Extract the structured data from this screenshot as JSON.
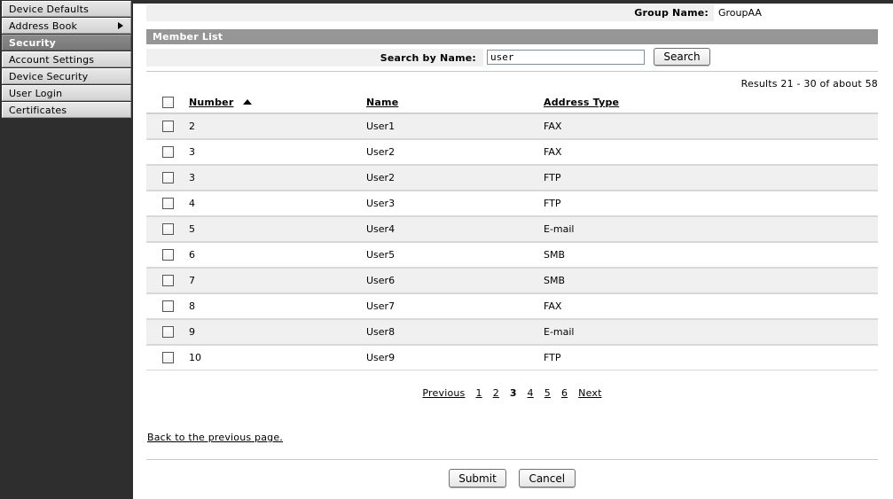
{
  "sidebar": {
    "items": [
      {
        "label": "Device Defaults",
        "selected": false,
        "has_arrow": false
      },
      {
        "label": "Address Book",
        "selected": false,
        "has_arrow": true
      },
      {
        "label": "Security",
        "selected": true,
        "has_arrow": false
      },
      {
        "label": "Account Settings",
        "selected": false,
        "has_arrow": false
      },
      {
        "label": "Device Security",
        "selected": false,
        "has_arrow": false
      },
      {
        "label": "User Login",
        "selected": false,
        "has_arrow": false
      },
      {
        "label": "Certificates",
        "selected": false,
        "has_arrow": false
      }
    ]
  },
  "header": {
    "group_name_label": "Group Name:",
    "group_name_value": "GroupAA"
  },
  "member_list": {
    "title": "Member List",
    "search_label": "Search by Name:",
    "search_value": "user",
    "search_placeholder": "",
    "search_button": "Search",
    "results_text": "Results 21 - 30 of about 58",
    "columns": [
      {
        "label": "Number",
        "sort": "asc"
      },
      {
        "label": "Name",
        "sort": ""
      },
      {
        "label": "Address Type",
        "sort": ""
      }
    ],
    "rows": [
      {
        "number": "2",
        "name": "User1",
        "type": "FAX"
      },
      {
        "number": "3",
        "name": "User2",
        "type": "FAX"
      },
      {
        "number": "3",
        "name": "User2",
        "type": "FTP"
      },
      {
        "number": "4",
        "name": "User3",
        "type": "FTP"
      },
      {
        "number": "5",
        "name": "User4",
        "type": "E-mail"
      },
      {
        "number": "6",
        "name": "User5",
        "type": "SMB"
      },
      {
        "number": "7",
        "name": "User6",
        "type": "SMB"
      },
      {
        "number": "8",
        "name": "User7",
        "type": "FAX"
      },
      {
        "number": "9",
        "name": "User8",
        "type": "E-mail"
      },
      {
        "number": "10",
        "name": "User9",
        "type": "FTP"
      }
    ]
  },
  "pagination": {
    "previous": "Previous",
    "pages": [
      "1",
      "2",
      "3",
      "4",
      "5",
      "6"
    ],
    "current": "3",
    "next": "Next"
  },
  "links": {
    "back": "Back to the previous page."
  },
  "footer": {
    "submit": "Submit",
    "cancel": "Cancel"
  },
  "colors": {
    "sidebar_bg": "#2e2e2e",
    "header_bar": "#969696",
    "band": "#f0f0f0",
    "row_alt": "#f0f0f0",
    "selected_nav": "#808080"
  }
}
